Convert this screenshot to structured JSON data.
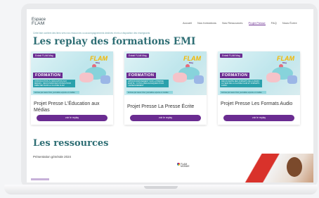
{
  "site": {
    "logo_line1": "Espace",
    "logo_line2": "FLAM"
  },
  "nav": {
    "links": [
      "Accueil",
      "Nos formations",
      "Nos Ressources",
      "Projet Presse",
      "FAQ",
      "Nous Écrire"
    ],
    "active_index": 3
  },
  "breadcrumb": "Cette liste contient des liens vers nos ressources ou accompagnements destinés et mis à disposition des enseignants",
  "replay_section": {
    "title": "Les replay des formations EMI",
    "cards": [
      {
        "badge": "Extrait FLAM Mag",
        "brand": "FLAM",
        "brand_sub": "Mag",
        "formation_label": "FORMATION",
        "thumb_subtitle": "Introduction à l'éducation aux médias : découvrir des pistes pour débuter dans la classe FLAM",
        "thumb_footer": "Animée par Laure Cizel, journaliste experte en médias",
        "title": "Projet Presse L'Éducation aux Médias",
        "button": "voir le replay"
      },
      {
        "badge": "Extrait FLAM Mag",
        "brand": "FLAM",
        "brand_sub": "Mag",
        "formation_label": "FORMATION",
        "thumb_subtitle": "Approfondissement sur la presse écrite : outils pédagogiques pour l'enseignement",
        "thumb_footer": "Animée par Laure Cizel, journaliste experte en médias",
        "title": "Projet Presse La Presse Écrite",
        "button": "voir le replay"
      },
      {
        "badge": "Extrait FLAM Mag",
        "brand": "FLAM",
        "brand_sub": "Mag",
        "formation_label": "FORMATION",
        "thumb_subtitle": "Découverte des formats de la radio au sein de la classe FLAM et formats audio",
        "thumb_footer": "Animée par Laure Cizel, journaliste experte en médias",
        "title": "Projet Presse Les Formats Audio",
        "button": "voir le replay"
      }
    ]
  },
  "resources": {
    "title": "Les ressources",
    "subtitle": "Présentation générale 2024",
    "logo_text_1": "FLAM",
    "logo_text_2": "MONDE"
  },
  "colors": {
    "teal_heading": "#2e6e74",
    "purple_button": "#6a2c91",
    "badge_yellow": "#f2b700"
  }
}
